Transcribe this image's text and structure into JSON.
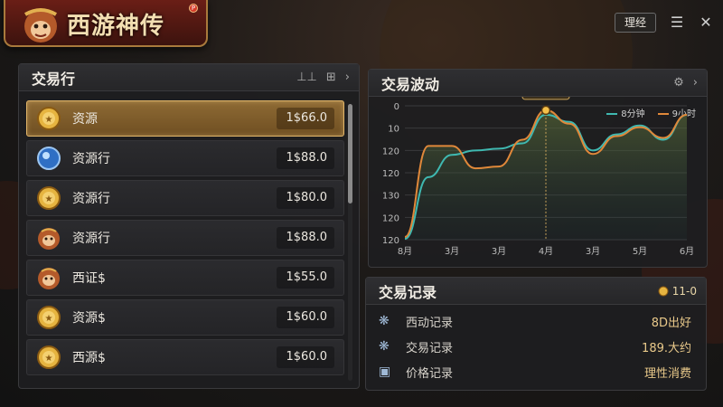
{
  "app": {
    "title": "西游神传",
    "badge": "P"
  },
  "top_bar": {
    "manage_label": "理经",
    "menu_icon": "list-icon",
    "close_icon": "close-icon"
  },
  "exchange": {
    "title": "交易行",
    "items": [
      {
        "icon": "gold-coin-icon",
        "label": "资源",
        "price": "1$66.0",
        "selected": true
      },
      {
        "icon": "blue-orb-icon",
        "label": "资源行",
        "price": "1$88.0",
        "selected": false
      },
      {
        "icon": "gold-coin-icon",
        "label": "资源行",
        "price": "1$80.0",
        "selected": false
      },
      {
        "icon": "monkey-face-icon",
        "label": "资源行",
        "price": "1$88.0",
        "selected": false
      },
      {
        "icon": "monkey-face-icon",
        "label": "西证$",
        "price": "1$55.0",
        "selected": false
      },
      {
        "icon": "gold-coin-icon",
        "label": "资源$",
        "price": "1$60.0",
        "selected": false
      },
      {
        "icon": "gold-coin-icon",
        "label": "西源$",
        "price": "1$60.0",
        "selected": false
      }
    ]
  },
  "fluctuation": {
    "title": "交易波动",
    "tooltip": "理性消费",
    "legend": [
      {
        "name": "8分钟",
        "color": "#3fb8b0"
      },
      {
        "name": "9小时",
        "color": "#e0883a"
      }
    ]
  },
  "chart_data": {
    "type": "line",
    "x_ticks": [
      "8月",
      "3月",
      "3月",
      "4月",
      "3月",
      "5月",
      "6月"
    ],
    "y_ticks": [
      "0",
      "10",
      "120",
      "120",
      "130",
      "120",
      "120"
    ],
    "x": [
      0,
      0.5,
      1,
      1.5,
      2,
      2.5,
      3,
      3.5,
      4,
      4.5,
      5,
      5.5,
      6
    ],
    "series": [
      {
        "name": "8分钟",
        "color": "#3fb8b0",
        "values": [
          1,
          70,
          95,
          100,
          102,
          108,
          140,
          132,
          100,
          118,
          128,
          112,
          140
        ]
      },
      {
        "name": "9小时",
        "color": "#e0883a",
        "values": [
          3,
          105,
          105,
          80,
          82,
          112,
          145,
          130,
          96,
          116,
          126,
          114,
          140
        ]
      }
    ]
  },
  "records": {
    "title": "交易记录",
    "badge": "11-0",
    "rows": [
      {
        "icon": "snowflake-icon",
        "label": "西动记录",
        "value": "8D出好"
      },
      {
        "icon": "snowflake-icon",
        "label": "交易记录",
        "value": "189.大约"
      },
      {
        "icon": "chart-card-icon",
        "label": "价格记录",
        "value": "理性消费"
      }
    ]
  }
}
